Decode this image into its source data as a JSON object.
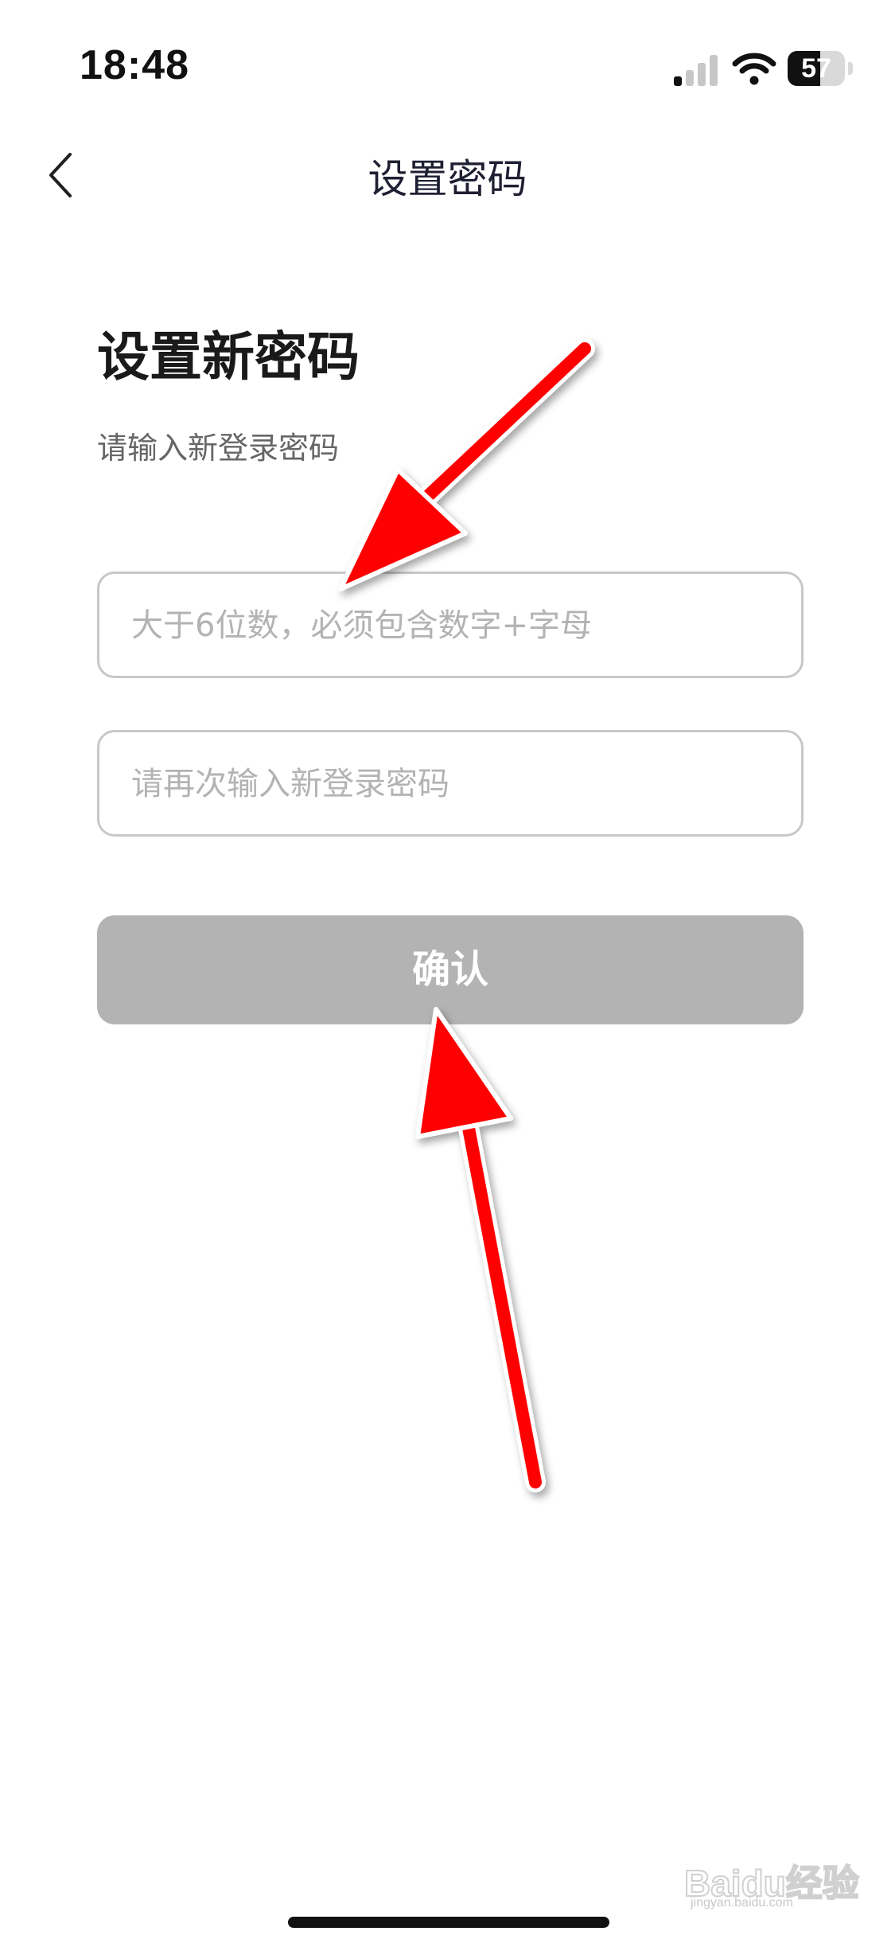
{
  "status_bar": {
    "time": "18:48",
    "battery_level": "57",
    "battery_fraction": 0.57
  },
  "nav": {
    "title": "设置密码",
    "back_icon": "chevron-left-icon"
  },
  "content": {
    "heading": "设置新密码",
    "subtitle": "请输入新登录密码",
    "password_input": {
      "placeholder": "大于6位数，必须包含数字+字母",
      "value": ""
    },
    "confirm_password_input": {
      "placeholder": "请再次输入新登录密码",
      "value": ""
    },
    "confirm_button_label": "确认"
  },
  "colors": {
    "button_disabled": "#b3b3b3",
    "annotation_arrow": "#ff0000",
    "input_border": "#c8c8c8"
  },
  "watermark": {
    "text": "Baidu经验",
    "sub": "jingyan.baidu.com"
  }
}
